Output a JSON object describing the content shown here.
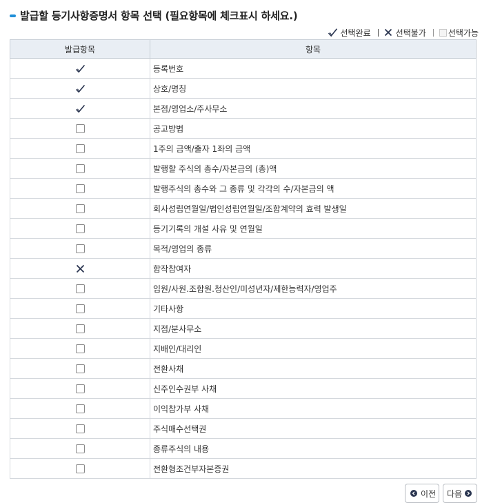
{
  "title": "발급할 등기사항증명서 항목 선택 (필요항목에 체크표시 하세요.)",
  "legend": {
    "selected": "선택완료",
    "unavailable": "선택불가",
    "available": "선택가능"
  },
  "table": {
    "headers": [
      "발급항목",
      "항목"
    ],
    "rows": [
      {
        "state": "checked",
        "label": "등록번호"
      },
      {
        "state": "checked",
        "label": "상호/명칭"
      },
      {
        "state": "checked",
        "label": "본점/영업소/주사무소"
      },
      {
        "state": "available",
        "label": "공고방법"
      },
      {
        "state": "available",
        "label": "1주의 금액/출자 1좌의 금액"
      },
      {
        "state": "available",
        "label": "발행할 주식의 총수/자본금의 (총)액"
      },
      {
        "state": "available",
        "label": "발행주식의 총수와 그 종류 및 각각의 수/자본금의 액"
      },
      {
        "state": "available",
        "label": "회사성립연월일/법인성립연월일/조합계약의 효력 발생일"
      },
      {
        "state": "available",
        "label": "등기기록의 개설 사유 및 연월일"
      },
      {
        "state": "available",
        "label": "목적/영업의 종류"
      },
      {
        "state": "unavailable",
        "label": "합작참여자"
      },
      {
        "state": "available",
        "label": "임원/사원.조합원.청산인/미성년자/제한능력자/영업주"
      },
      {
        "state": "available",
        "label": "기타사항"
      },
      {
        "state": "available",
        "label": "지점/분사무소"
      },
      {
        "state": "available",
        "label": "지배인/대리인"
      },
      {
        "state": "available",
        "label": "전환사채"
      },
      {
        "state": "available",
        "label": "신주인수권부 사채"
      },
      {
        "state": "available",
        "label": "이익참가부 사채"
      },
      {
        "state": "available",
        "label": "주식매수선택권"
      },
      {
        "state": "available",
        "label": "종류주식의 내용"
      },
      {
        "state": "available",
        "label": "전환형조건부자본증권"
      }
    ]
  },
  "pagination": {
    "prev_label": "이전",
    "next_label": "다음"
  },
  "colors": {
    "accent": "#1f8fd8",
    "header_bg": "#e9eef4",
    "mark": "#2a3550"
  }
}
